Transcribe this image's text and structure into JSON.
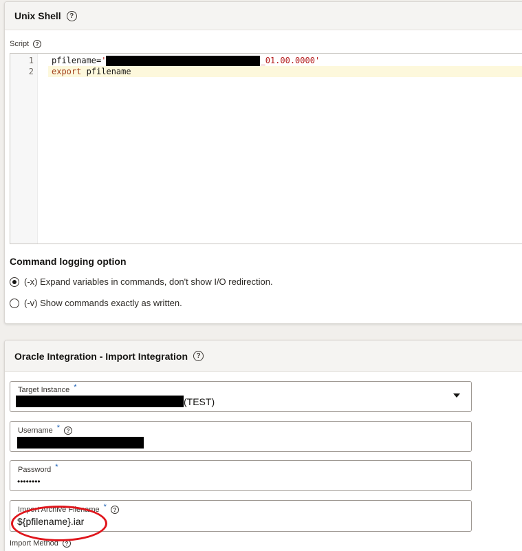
{
  "unix_shell": {
    "title": "Unix Shell",
    "script_label": "Script",
    "code_lines": [
      {
        "number": "1",
        "prefix": "pfilename=",
        "string_start": "'",
        "string_end": "_01.00.0000'"
      },
      {
        "number": "2",
        "keyword": "export",
        "rest": " pfilename"
      }
    ],
    "logging_title": "Command logging option",
    "options": [
      {
        "label": "(-x) Expand variables in commands, don't show I/O redirection.",
        "selected": true
      },
      {
        "label": "(-v) Show commands exactly as written.",
        "selected": false
      }
    ]
  },
  "oracle_integration": {
    "title": "Oracle Integration - Import Integration",
    "fields": {
      "target_instance": {
        "label": "Target Instance",
        "required": "*",
        "value_suffix": "(TEST)"
      },
      "username": {
        "label": "Username",
        "required": "*"
      },
      "password": {
        "label": "Password",
        "required": "*",
        "value": "••••••••"
      },
      "archive_filename": {
        "label": "Import Archive Filename",
        "required": "*",
        "value": "${pfilename}.iar"
      },
      "import_method": {
        "label": "Import Method"
      }
    }
  },
  "icons": {
    "help": "help-circle-icon",
    "dropdown": "chevron-down-icon"
  },
  "colors": {
    "annotation_circle": "#e0161c",
    "required_marker": "#1b5fb4",
    "active_line": "#fdf8dc"
  }
}
